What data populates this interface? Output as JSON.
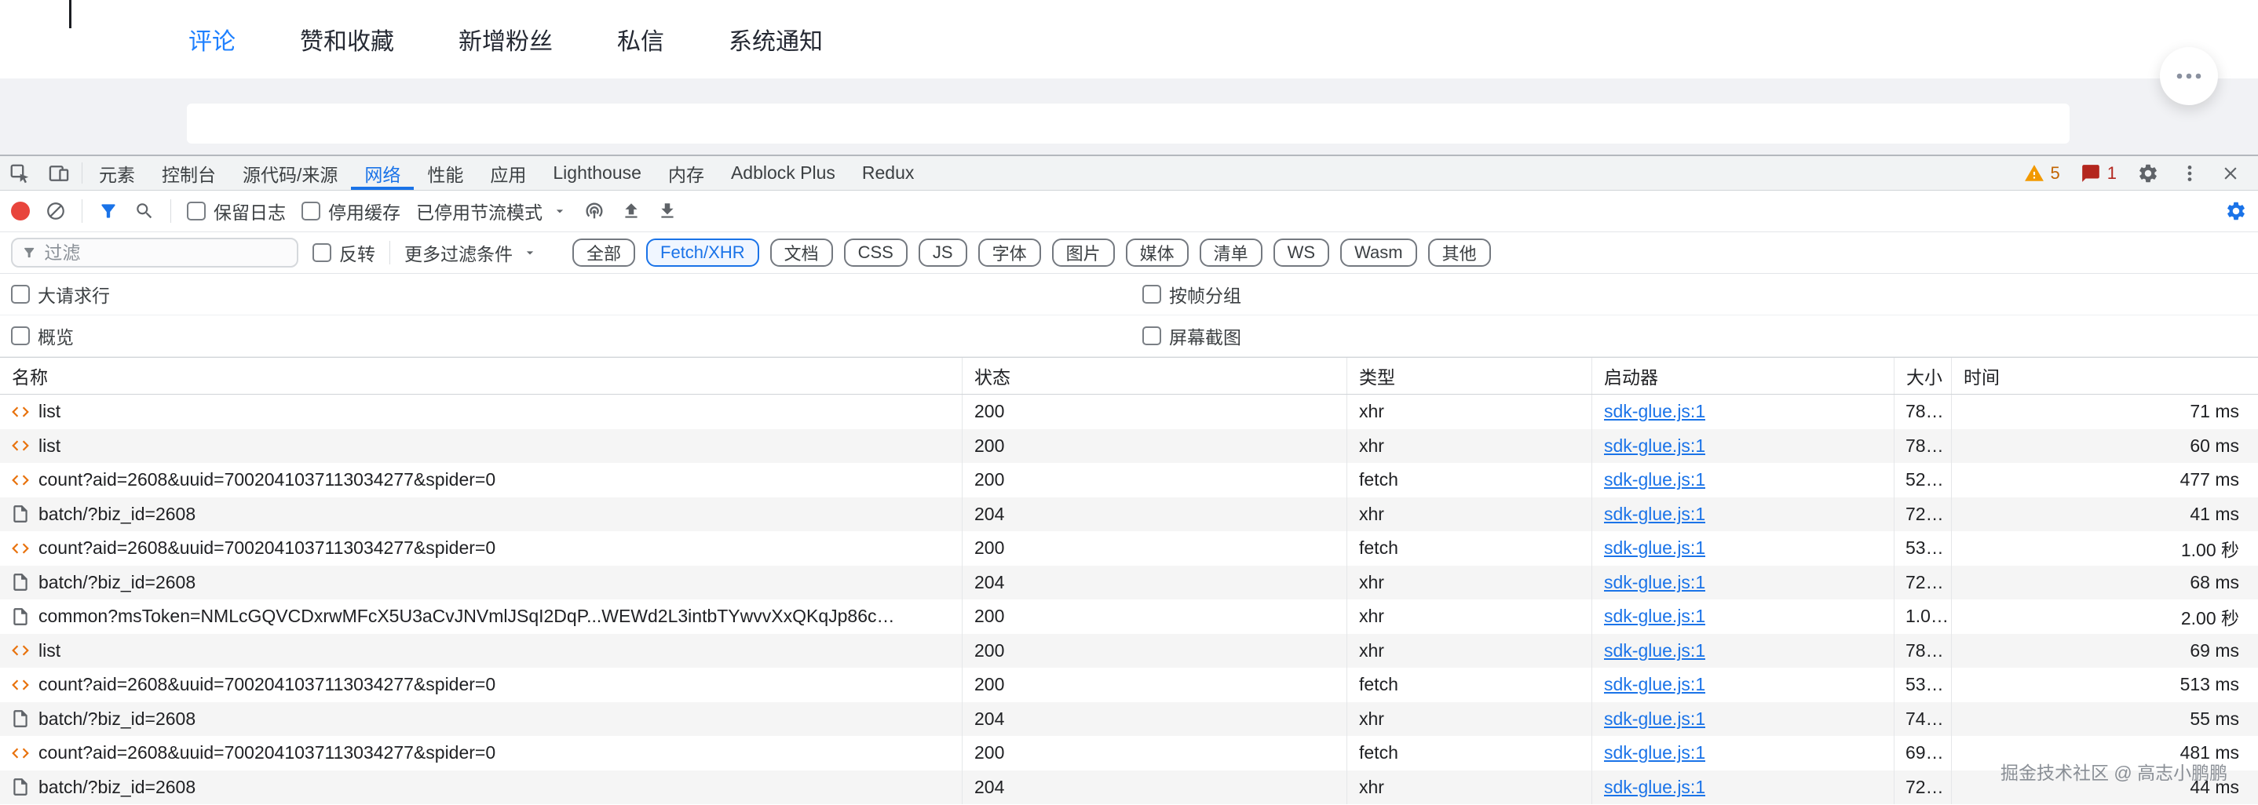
{
  "site": {
    "tabs": [
      {
        "label": "评论",
        "active": true
      },
      {
        "label": "赞和收藏"
      },
      {
        "label": "新增粉丝"
      },
      {
        "label": "私信"
      },
      {
        "label": "系统通知"
      }
    ]
  },
  "devtools": {
    "tabs": [
      {
        "label": "元素"
      },
      {
        "label": "控制台"
      },
      {
        "label": "源代码/来源"
      },
      {
        "label": "网络",
        "active": true
      },
      {
        "label": "性能"
      },
      {
        "label": "应用"
      },
      {
        "label": "Lighthouse"
      },
      {
        "label": "内存"
      },
      {
        "label": "Adblock Plus"
      },
      {
        "label": "Redux"
      }
    ],
    "warning_count": "5",
    "issue_count": "1",
    "toolbar": {
      "preserve_log": "保留日志",
      "disable_cache": "停用缓存",
      "throttling": "已停用节流模式"
    },
    "filter": {
      "placeholder": "过滤",
      "invert_label": "反转",
      "more_filters_label": "更多过滤条件",
      "chips": [
        {
          "label": "全部"
        },
        {
          "label": "Fetch/XHR",
          "active": true
        },
        {
          "label": "文档"
        },
        {
          "label": "CSS"
        },
        {
          "label": "JS"
        },
        {
          "label": "字体"
        },
        {
          "label": "图片"
        },
        {
          "label": "媒体"
        },
        {
          "label": "清单"
        },
        {
          "label": "WS"
        },
        {
          "label": "Wasm"
        },
        {
          "label": "其他"
        }
      ]
    },
    "options": {
      "big_request_rows": "大请求行",
      "group_by_frame": "按帧分组",
      "overview": "概览",
      "screenshots": "屏幕截图"
    },
    "table": {
      "columns": [
        "名称",
        "状态",
        "类型",
        "启动器",
        "大小",
        "时间"
      ],
      "rows": [
        {
          "icon": "code-icon",
          "name": "list",
          "status": "200",
          "type": "xhr",
          "initiator": "sdk-glue.js:1",
          "size": "78…",
          "time": "71 ms"
        },
        {
          "icon": "code-icon",
          "name": "list",
          "status": "200",
          "type": "xhr",
          "initiator": "sdk-glue.js:1",
          "size": "78…",
          "time": "60 ms"
        },
        {
          "icon": "code-icon",
          "name": "count?aid=2608&uuid=7002041037113034277&spider=0",
          "status": "200",
          "type": "fetch",
          "initiator": "sdk-glue.js:1",
          "size": "52…",
          "time": "477 ms"
        },
        {
          "icon": "document-icon",
          "name": "batch/?biz_id=2608",
          "status": "204",
          "type": "xhr",
          "initiator": "sdk-glue.js:1",
          "size": "72…",
          "time": "41 ms"
        },
        {
          "icon": "code-icon",
          "name": "count?aid=2608&uuid=7002041037113034277&spider=0",
          "status": "200",
          "type": "fetch",
          "initiator": "sdk-glue.js:1",
          "size": "53…",
          "time": "1.00 秒"
        },
        {
          "icon": "document-icon",
          "name": "batch/?biz_id=2608",
          "status": "204",
          "type": "xhr",
          "initiator": "sdk-glue.js:1",
          "size": "72…",
          "time": "68 ms"
        },
        {
          "icon": "document-icon",
          "name": "common?msToken=NMLcGQVCDxrwMFcX5U3aCvJNVmlJSqI2DqP...WEWd2L3intbTYwvvXxQKqJp86c…",
          "status": "200",
          "type": "xhr",
          "initiator": "sdk-glue.js:1",
          "size": "1.0 …",
          "time": "2.00 秒"
        },
        {
          "icon": "code-icon",
          "name": "list",
          "status": "200",
          "type": "xhr",
          "initiator": "sdk-glue.js:1",
          "size": "78…",
          "time": "69 ms"
        },
        {
          "icon": "code-icon",
          "name": "count?aid=2608&uuid=7002041037113034277&spider=0",
          "status": "200",
          "type": "fetch",
          "initiator": "sdk-glue.js:1",
          "size": "53…",
          "time": "513 ms"
        },
        {
          "icon": "document-icon",
          "name": "batch/?biz_id=2608",
          "status": "204",
          "type": "xhr",
          "initiator": "sdk-glue.js:1",
          "size": "74…",
          "time": "55 ms"
        },
        {
          "icon": "code-icon",
          "name": "count?aid=2608&uuid=7002041037113034277&spider=0",
          "status": "200",
          "type": "fetch",
          "initiator": "sdk-glue.js:1",
          "size": "69…",
          "time": "481 ms"
        },
        {
          "icon": "document-icon",
          "name": "batch/?biz_id=2608",
          "status": "204",
          "type": "xhr",
          "initiator": "sdk-glue.js:1",
          "size": "72…",
          "time": "44 ms"
        }
      ]
    }
  },
  "watermark": "掘金技术社区 @ 高志小鹏鹏",
  "colors": {
    "site_accent": "#1e80ff",
    "devtools_accent": "#1a73e8",
    "warning": "#f29900",
    "error": "#b3261e",
    "record": "#e8453c",
    "stripe": "#f5f5f5"
  }
}
